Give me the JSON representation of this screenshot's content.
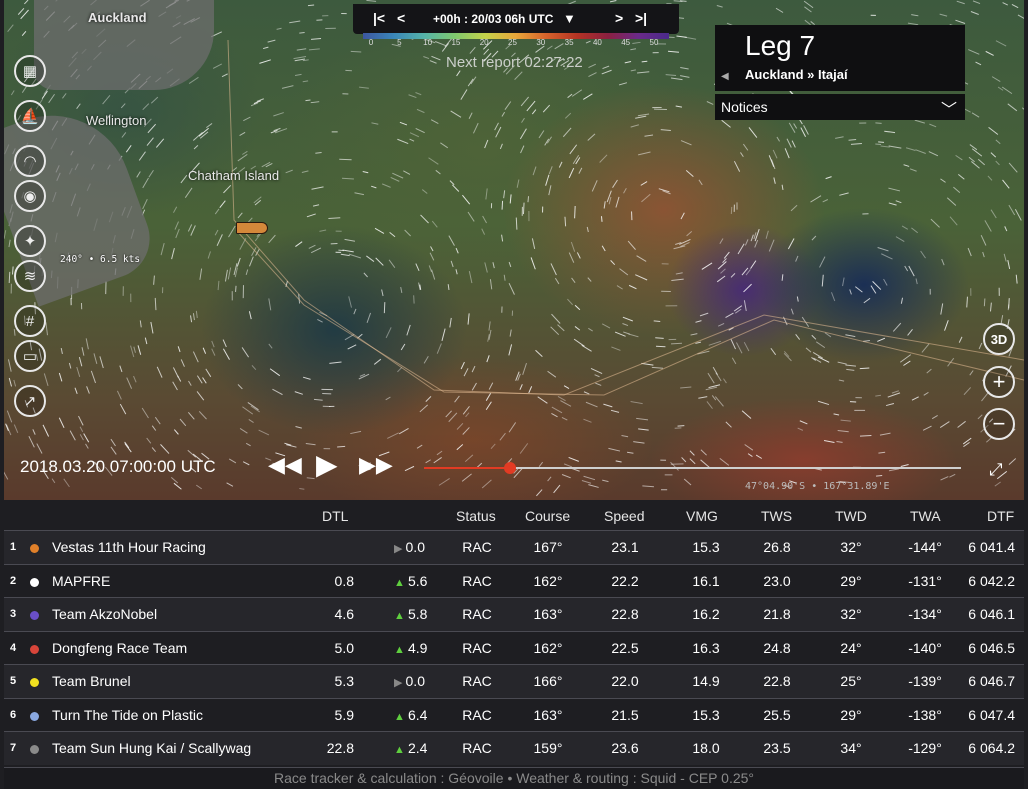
{
  "map": {
    "places": [
      {
        "name": "Auckland",
        "id": "auckland"
      },
      {
        "name": "Wellington",
        "id": "wellington"
      },
      {
        "name": "Chatham Island",
        "id": "chatham"
      }
    ],
    "boat_info": "240° • 6.5 kts",
    "coords": "47°04.90'S • 167°31.89'E",
    "next_report": "Next report 02:27:22"
  },
  "timebar": {
    "time_label": "+00h : 20/03 06h UTC",
    "scale": [
      "0",
      "5",
      "10",
      "15",
      "20",
      "25",
      "30",
      "35",
      "40",
      "45",
      "50"
    ]
  },
  "leg": {
    "title": "Leg 7",
    "route": "Auckland » Itajaí",
    "notices": "Notices"
  },
  "zoom": {
    "three_d": "3D"
  },
  "playback": {
    "date": "2018.03.20 07:00:00 UTC",
    "progress": 0.16
  },
  "table": {
    "headers": {
      "dtl": "DTL",
      "status": "Status",
      "course": "Course",
      "speed": "Speed",
      "vmg": "VMG",
      "tws": "TWS",
      "twd": "TWD",
      "twa": "TWA",
      "dtf": "DTF"
    },
    "rows": [
      {
        "rank": "1",
        "color": "#e0802a",
        "name": "Vestas 11th Hour Racing",
        "dtl": "",
        "trend": "flat",
        "change": "0.0",
        "status": "RAC",
        "course": "167°",
        "speed": "23.1",
        "vmg": "15.3",
        "tws": "26.8",
        "twd": "32°",
        "twa": "-144°",
        "dtf": "6 041.4"
      },
      {
        "rank": "2",
        "color": "#ffffff",
        "name": "MAPFRE",
        "dtl": "0.8",
        "trend": "up",
        "change": "5.6",
        "status": "RAC",
        "course": "162°",
        "speed": "22.2",
        "vmg": "16.1",
        "tws": "23.0",
        "twd": "29°",
        "twa": "-131°",
        "dtf": "6 042.2"
      },
      {
        "rank": "3",
        "color": "#6a4fc8",
        "name": "Team AkzoNobel",
        "dtl": "4.6",
        "trend": "up",
        "change": "5.8",
        "status": "RAC",
        "course": "163°",
        "speed": "22.8",
        "vmg": "16.2",
        "tws": "21.8",
        "twd": "32°",
        "twa": "-134°",
        "dtf": "6 046.1"
      },
      {
        "rank": "4",
        "color": "#d8453a",
        "name": "Dongfeng Race Team",
        "dtl": "5.0",
        "trend": "up",
        "change": "4.9",
        "status": "RAC",
        "course": "162°",
        "speed": "22.5",
        "vmg": "16.3",
        "tws": "24.8",
        "twd": "24°",
        "twa": "-140°",
        "dtf": "6 046.5"
      },
      {
        "rank": "5",
        "color": "#f0e020",
        "name": "Team Brunel",
        "dtl": "5.3",
        "trend": "flat",
        "change": "0.0",
        "status": "RAC",
        "course": "166°",
        "speed": "22.0",
        "vmg": "14.9",
        "tws": "22.8",
        "twd": "25°",
        "twa": "-139°",
        "dtf": "6 046.7"
      },
      {
        "rank": "6",
        "color": "#8aa8e0",
        "name": "Turn The Tide on Plastic",
        "dtl": "5.9",
        "trend": "up",
        "change": "6.4",
        "status": "RAC",
        "course": "163°",
        "speed": "21.5",
        "vmg": "15.3",
        "tws": "25.5",
        "twd": "29°",
        "twa": "-138°",
        "dtf": "6 047.4"
      },
      {
        "rank": "7",
        "color": "#8a8a8a",
        "name": "Team Sun Hung Kai / Scallywag",
        "dtl": "22.8",
        "trend": "up",
        "change": "2.4",
        "status": "RAC",
        "course": "159°",
        "speed": "23.6",
        "vmg": "18.0",
        "tws": "23.5",
        "twd": "34°",
        "twa": "-129°",
        "dtf": "6 064.2"
      }
    ]
  },
  "footer": "Race tracker & calculation : Géovoile • Weather & routing : Squid - CEP 0.25°"
}
